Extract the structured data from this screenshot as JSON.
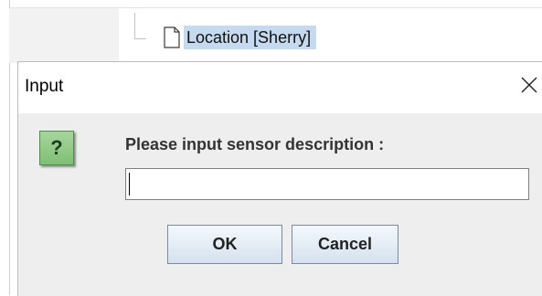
{
  "background": {
    "tree_item": {
      "label": "Location [Sherry]",
      "icon": "document-icon"
    }
  },
  "dialog": {
    "title": "Input",
    "close_icon": "close-icon",
    "message_icon": "question-icon",
    "message_icon_glyph": "?",
    "prompt": "Please input sensor description :",
    "input": {
      "value": "",
      "placeholder": ""
    },
    "buttons": {
      "ok_label": "OK",
      "cancel_label": "Cancel"
    }
  },
  "colors": {
    "selection_highlight": "#c5d9ef",
    "question_icon_bg": "#8ec886",
    "button_gradient_top": "#f4f8fc",
    "button_gradient_bottom": "#d5e1ee"
  }
}
